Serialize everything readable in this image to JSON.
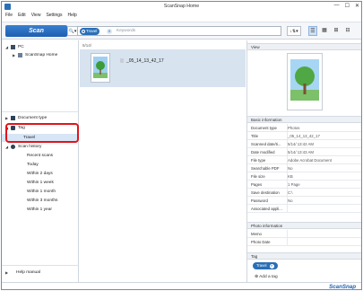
{
  "window": {
    "title": "ScanSnap Home",
    "controls": [
      "—",
      "☐",
      "✕"
    ]
  },
  "menu": [
    "File",
    "Edit",
    "View",
    "Settings",
    "Help"
  ],
  "toolbar": {
    "scan_label": "Scan",
    "search_icon_glyph": "🔍▾",
    "search_tag": "Travel",
    "search_placeholder": "Keywords",
    "sort_glyph": "↓⇅▾",
    "view_modes": [
      "☰",
      "▦",
      "⊞",
      "⊟"
    ]
  },
  "sidebar": {
    "pc_label": "PC",
    "scansnap_home_label": "ScanSnap Home",
    "document_type_label": "Document type",
    "tag_label": "Tag",
    "tag_selected": "Travel",
    "scan_history_label": "Scan history",
    "history_items": [
      "Recent scans",
      "Today",
      "Within 2 days",
      "Within 1 week",
      "Within 1 month",
      "Within 3 months",
      "Within 1 year"
    ],
    "help_label": "Help manual"
  },
  "center": {
    "date_header": "5/14/",
    "doc_name": "_05_14_13_42_17"
  },
  "right": {
    "view_header": "View",
    "basic_info_header": "Basic information",
    "properties": [
      {
        "key": "Document type",
        "value": "Photos"
      },
      {
        "key": "Title",
        "value": "_05_14_13_42_17"
      },
      {
        "key": "Scanned date/ti...",
        "value": "5/14/ 13:42 AM"
      },
      {
        "key": "Date modified",
        "value": "5/14/ 13:43 AM"
      },
      {
        "key": "File type",
        "value": "Adobe Acrobat Document"
      },
      {
        "key": "Searchable PDF",
        "value": "No"
      },
      {
        "key": "File size",
        "value": "KB"
      },
      {
        "key": "Pages",
        "value": "1 Page"
      },
      {
        "key": "Save destination",
        "value": "C:\\"
      },
      {
        "key": "Password",
        "value": "No"
      },
      {
        "key": "Associated appli...",
        "value": ""
      }
    ],
    "photo_info_header": "Photo information",
    "photo_properties": [
      {
        "key": "Memo",
        "value": ""
      },
      {
        "key": "Photo Date",
        "value": ""
      }
    ],
    "tag_header": "Tag",
    "tag_chip": "Travel",
    "add_tag_label": "Add a tag"
  },
  "footer": {
    "logo": "ScanSnap"
  },
  "colors": {
    "accent": "#2a6fb6",
    "highlight": "#e0141a",
    "selected": "#d7e6f6"
  }
}
